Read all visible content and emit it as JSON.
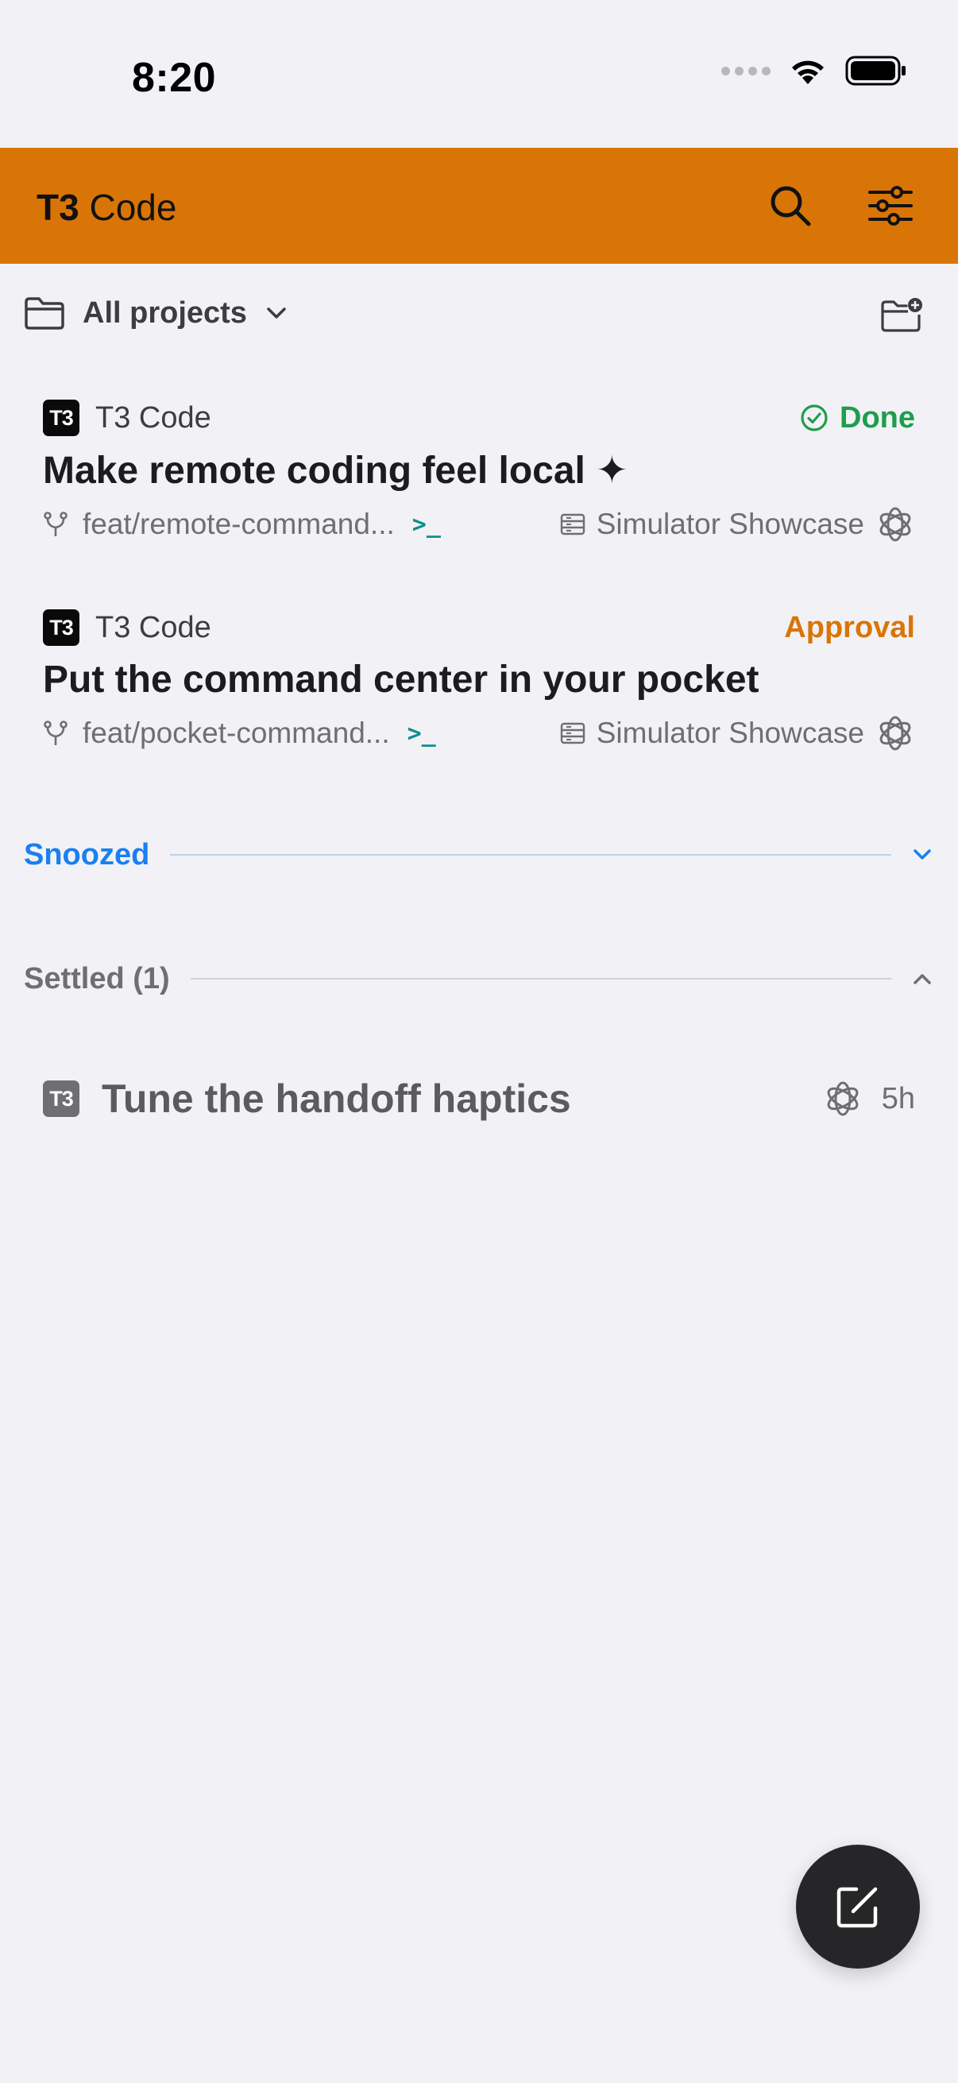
{
  "status_bar": {
    "time": "8:20"
  },
  "header": {
    "title_bold": "T3",
    "title_rest": " Code",
    "search_icon": "search-icon",
    "filter_icon": "sliders-icon",
    "accent": "#d97506"
  },
  "filter": {
    "label": "All projects",
    "folder_icon": "folder-icon",
    "new_folder_icon": "folder-plus-icon"
  },
  "threads": [
    {
      "project_badge": "T3",
      "project": "T3 Code",
      "status": "Done",
      "status_color": "#1f9d4c",
      "title": "Make remote coding feel local ✦",
      "branch": "feat/remote-command...",
      "terminal": ">_",
      "environment": "Simulator Showcase",
      "model_icon": "openai-icon"
    },
    {
      "project_badge": "T3",
      "project": "T3 Code",
      "status": "Approval",
      "status_color": "#d97506",
      "title": "Put the command center in your pocket",
      "branch": "feat/pocket-command...",
      "terminal": ">_",
      "environment": "Simulator Showcase",
      "model_icon": "openai-icon"
    }
  ],
  "sections": {
    "snoozed": {
      "label": "Snoozed",
      "color": "#1a7ff0"
    },
    "settled": {
      "label": "Settled (1)"
    }
  },
  "settled_threads": [
    {
      "project_badge": "T3",
      "title": "Tune the handoff haptics",
      "age": "5h",
      "model_icon": "openai-icon"
    }
  ],
  "fab": {
    "icon": "compose-icon"
  }
}
